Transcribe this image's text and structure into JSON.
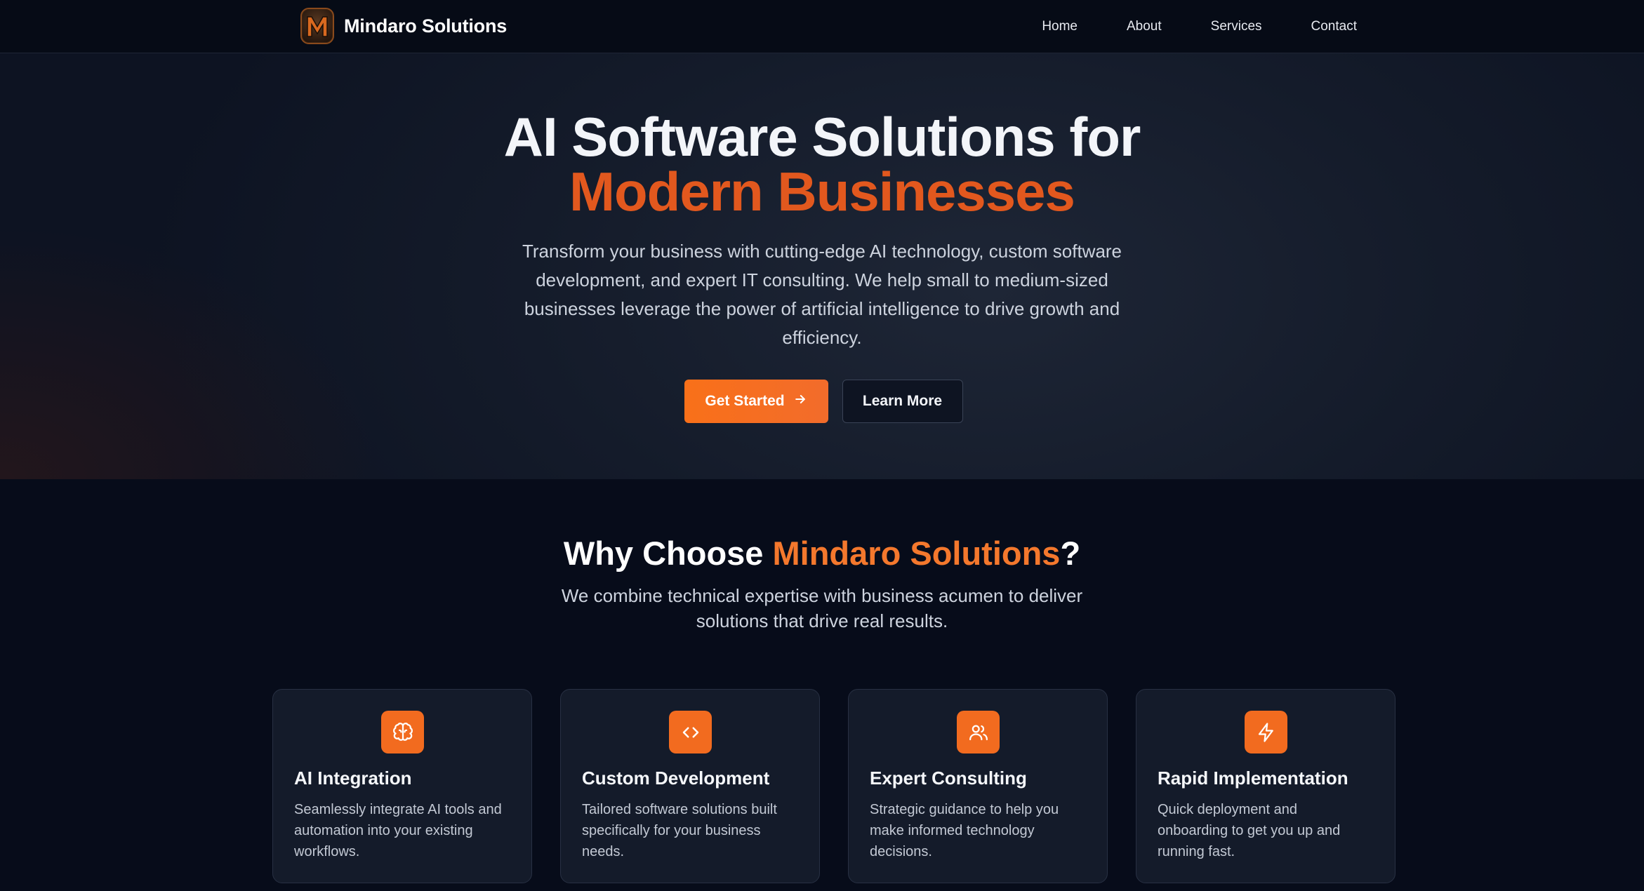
{
  "colors": {
    "accent": "#f26b1f",
    "accent_text": "#e2581e",
    "background": "#070c1a",
    "card_bg": "#141b2a"
  },
  "nav": {
    "brand": "Mindaro Solutions",
    "logo_icon": "mindaro-m-logo-icon",
    "links": [
      {
        "label": "Home"
      },
      {
        "label": "About"
      },
      {
        "label": "Services"
      },
      {
        "label": "Contact"
      }
    ]
  },
  "hero": {
    "title_line1": "AI Software Solutions for",
    "title_line2": "Modern Businesses",
    "description": "Transform your business with cutting-edge AI technology, custom software development, and expert IT consulting. We help small to medium-sized businesses leverage the power of artificial intelligence to drive growth and efficiency.",
    "primary_button": "Get Started",
    "primary_button_icon": "arrow-right-icon",
    "secondary_button": "Learn More"
  },
  "why": {
    "title_prefix": "Why Choose ",
    "title_accent": "Mindaro Solutions",
    "title_suffix": "?",
    "subtitle": "We combine technical expertise with business acumen to deliver solutions that drive real results.",
    "cards": [
      {
        "icon": "brain-icon",
        "title": "AI Integration",
        "description": "Seamlessly integrate AI tools and automation into your existing workflows."
      },
      {
        "icon": "code-icon",
        "title": "Custom Development",
        "description": "Tailored software solutions built specifically for your business needs."
      },
      {
        "icon": "users-icon",
        "title": "Expert Consulting",
        "description": "Strategic guidance to help you make informed technology decisions."
      },
      {
        "icon": "lightning-icon",
        "title": "Rapid Implementation",
        "description": "Quick deployment and onboarding to get you up and running fast."
      }
    ]
  }
}
